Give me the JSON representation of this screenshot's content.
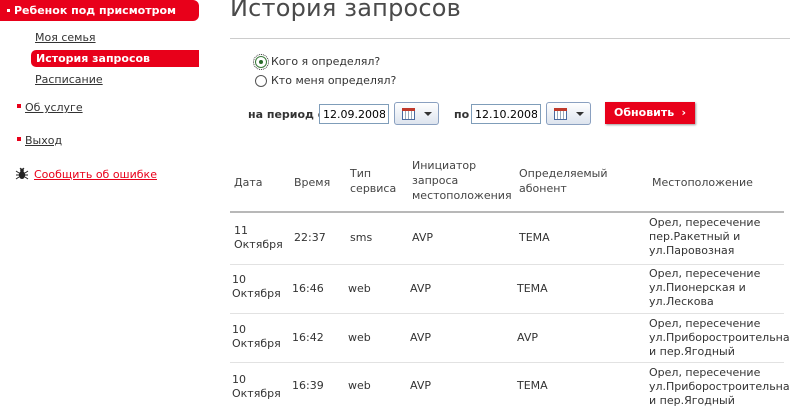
{
  "sidebar": {
    "header": "Ребенок под присмотром",
    "sub_items": [
      "Моя семья",
      "История запросов",
      "Расписание"
    ],
    "active_sub": "История запросов",
    "links": [
      "Об услуге",
      "Выход"
    ],
    "report_error": "Сообщить об ошибке"
  },
  "page": {
    "title": "История запросов",
    "radio_1": "Кого я определял?",
    "radio_2": "Кто меня определял?",
    "radio_selected": 1,
    "period_from_label": "на период с",
    "date_from": "12.09.2008",
    "period_to_label": "по",
    "date_to": "12.10.2008",
    "refresh_label": "Обновить",
    "refresh_arrow": "›"
  },
  "table": {
    "headers": [
      [
        "Дата"
      ],
      [
        "Время"
      ],
      [
        "Тип",
        "сервиса"
      ],
      [
        "Инициатор",
        "запроса",
        "местоположения"
      ],
      [
        "Определяемый",
        "абонент"
      ],
      [
        "Местоположение"
      ]
    ],
    "rows": [
      {
        "date": [
          "11",
          "Октября"
        ],
        "time": "22:37",
        "type": "sms",
        "initiator": "AVP",
        "target": "TEMA",
        "location": [
          "Орел, пересечение",
          "пер.Ракетный и",
          "ул.Паровозная"
        ]
      },
      {
        "date": [
          "10",
          "Октября"
        ],
        "time": "16:46",
        "type": "web",
        "initiator": "AVP",
        "target": "TEMA",
        "location": [
          "Орел, пересечение",
          "ул.Пионерская и",
          "ул.Лескова"
        ]
      },
      {
        "date": [
          "10",
          "Октября"
        ],
        "time": "16:42",
        "type": "web",
        "initiator": "AVP",
        "target": "AVP",
        "location": [
          "Орел, пересечение",
          "ул.Приборостроительная",
          "и пер.Ягодный"
        ]
      },
      {
        "date": [
          "10",
          "Октября"
        ],
        "time": "16:39",
        "type": "web",
        "initiator": "AVP",
        "target": "TEMA",
        "location": [
          "Орел, пересечение",
          "ул.Приборостроительная",
          "и пер.Ягодный"
        ]
      }
    ]
  },
  "colors": {
    "accent": "#e8001a"
  }
}
